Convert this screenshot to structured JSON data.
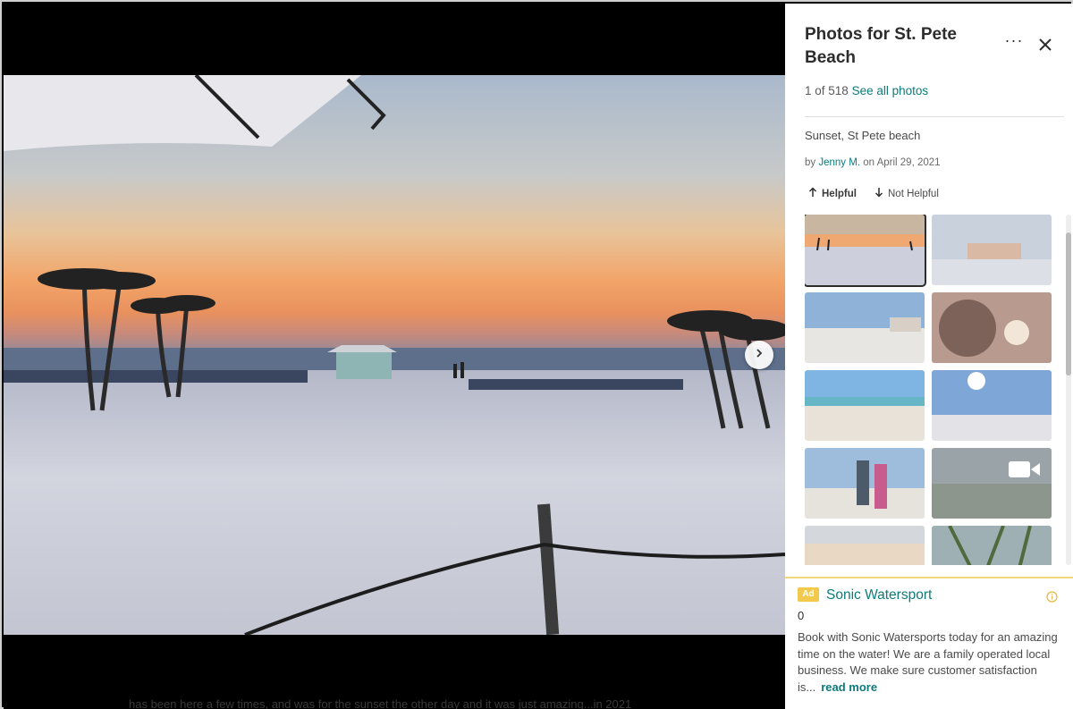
{
  "panel": {
    "title": "Photos for St. Pete Beach",
    "count_text": "1 of 518",
    "see_all": "See all photos",
    "more_label": "···",
    "caption": "Sunset, St Pete beach",
    "by_prefix": "by",
    "author": "Jenny M.",
    "date_text": "on April 29, 2021",
    "helpful_label": "Helpful",
    "not_helpful_label": "Not Helpful"
  },
  "thumbnails": [
    {
      "name": "thumb-sunset-beach",
      "selected": true
    },
    {
      "name": "thumb-hotel-beach"
    },
    {
      "name": "thumb-crowded-beach"
    },
    {
      "name": "thumb-selfie-sun"
    },
    {
      "name": "thumb-shoreline"
    },
    {
      "name": "thumb-sunny-beach"
    },
    {
      "name": "thumb-couple-beach"
    },
    {
      "name": "thumb-video-waves",
      "video": true
    },
    {
      "name": "thumb-hazy-sky"
    },
    {
      "name": "thumb-palm-leaves"
    }
  ],
  "ad": {
    "badge": "Ad",
    "name": "Sonic Watersport",
    "rating": "0",
    "text": "Book with Sonic Watersports today for an amazing time on the water! We are a family operated local business. We make sure customer satisfaction is...",
    "read_more": "read more"
  },
  "colors": {
    "accent": "#0d7a7a",
    "ad_badge": "#f2c94c"
  },
  "background_snippet": "has been here a few times, and was for the sunset the other day and it was just amazing...in 2021"
}
